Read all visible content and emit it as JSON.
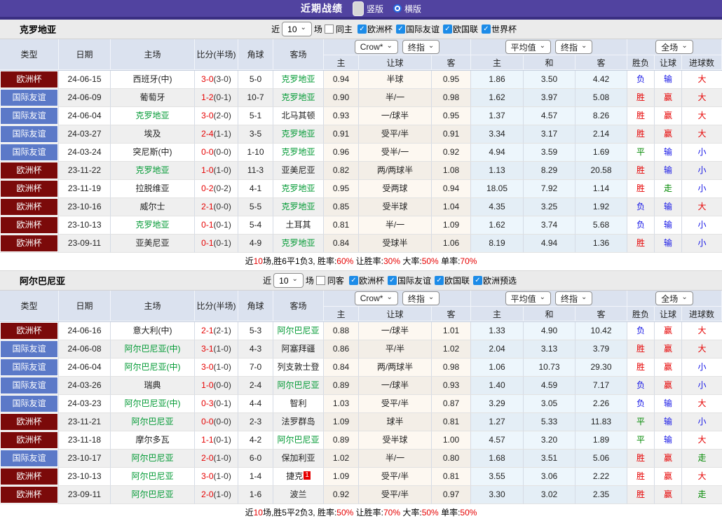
{
  "top": {
    "title": "近期战绩",
    "radios": [
      "竖版",
      "横版"
    ]
  },
  "colors": {
    "topbar": "#5143a0",
    "cup": "#7b0a0a",
    "friendly": "#5b79c8",
    "team_green": "#009933",
    "score_red": "#e60000",
    "win_red": "#e60000",
    "lose_blue": "#1414e6",
    "draw_green": "#008800"
  },
  "sections": [
    {
      "name": "克罗地亚",
      "filters": {
        "near": "近",
        "count": "10",
        "games": "场",
        "same": "同主",
        "leagues": [
          "欧洲杯",
          "国际友谊",
          "欧国联",
          "世界杯"
        ]
      },
      "dropdowns": {
        "book": "Crow*",
        "final1": "终指",
        "avg": "平均值",
        "final2": "终指",
        "scope": "全场"
      },
      "headers": {
        "type": "类型",
        "date": "日期",
        "home": "主场",
        "score": "比分(半场)",
        "corner": "角球",
        "away": "客场",
        "o_home": "主",
        "o_line": "让球",
        "o_away": "客",
        "a_home": "主",
        "a_draw": "和",
        "a_away": "客",
        "r_wl": "胜负",
        "r_handicap": "让球",
        "r_goals": "进球数"
      },
      "rows": [
        {
          "type": "欧洲杯",
          "date": "24-06-15",
          "home": "西班牙(中)",
          "score": "3-0",
          "half": "(3-0)",
          "corner": "5-0",
          "away": "克罗地亚",
          "o1": "0.94",
          "line": "半球",
          "o2": "0.95",
          "a1": "1.86",
          "a2": "3.50",
          "a3": "4.42",
          "r1": "负",
          "r2": "输",
          "r3": "大"
        },
        {
          "type": "国际友谊",
          "date": "24-06-09",
          "home": "葡萄牙",
          "score": "1-2",
          "half": "(0-1)",
          "corner": "10-7",
          "away": "克罗地亚",
          "o1": "0.90",
          "line": "半/一",
          "o2": "0.98",
          "a1": "1.62",
          "a2": "3.97",
          "a3": "5.08",
          "r1": "胜",
          "r2": "赢",
          "r3": "大"
        },
        {
          "type": "国际友谊",
          "date": "24-06-04",
          "home": "克罗地亚",
          "score": "3-0",
          "half": "(2-0)",
          "corner": "5-1",
          "away": "北马其顿",
          "o1": "0.93",
          "line": "一/球半",
          "o2": "0.95",
          "a1": "1.37",
          "a2": "4.57",
          "a3": "8.26",
          "r1": "胜",
          "r2": "赢",
          "r3": "大"
        },
        {
          "type": "国际友谊",
          "date": "24-03-27",
          "home": "埃及",
          "score": "2-4",
          "half": "(1-1)",
          "corner": "3-5",
          "away": "克罗地亚",
          "o1": "0.91",
          "line": "受平/半",
          "o2": "0.91",
          "a1": "3.34",
          "a2": "3.17",
          "a3": "2.14",
          "r1": "胜",
          "r2": "赢",
          "r3": "大"
        },
        {
          "type": "国际友谊",
          "date": "24-03-24",
          "home": "突尼斯(中)",
          "score": "0-0",
          "half": "(0-0)",
          "corner": "1-10",
          "away": "克罗地亚",
          "o1": "0.96",
          "line": "受半/一",
          "o2": "0.92",
          "a1": "4.94",
          "a2": "3.59",
          "a3": "1.69",
          "r1": "平",
          "r2": "输",
          "r3": "小"
        },
        {
          "type": "欧洲杯",
          "date": "23-11-22",
          "home": "克罗地亚",
          "score": "1-0",
          "half": "(1-0)",
          "corner": "11-3",
          "away": "亚美尼亚",
          "o1": "0.82",
          "line": "两/两球半",
          "o2": "1.08",
          "a1": "1.13",
          "a2": "8.29",
          "a3": "20.58",
          "r1": "胜",
          "r2": "输",
          "r3": "小"
        },
        {
          "type": "欧洲杯",
          "date": "23-11-19",
          "home": "拉脱维亚",
          "score": "0-2",
          "half": "(0-2)",
          "corner": "4-1",
          "away": "克罗地亚",
          "o1": "0.95",
          "line": "受两球",
          "o2": "0.94",
          "a1": "18.05",
          "a2": "7.92",
          "a3": "1.14",
          "r1": "胜",
          "r2": "走",
          "r3": "小"
        },
        {
          "type": "欧洲杯",
          "date": "23-10-16",
          "home": "威尔士",
          "score": "2-1",
          "half": "(0-0)",
          "corner": "5-5",
          "away": "克罗地亚",
          "o1": "0.85",
          "line": "受半球",
          "o2": "1.04",
          "a1": "4.35",
          "a2": "3.25",
          "a3": "1.92",
          "r1": "负",
          "r2": "输",
          "r3": "大"
        },
        {
          "type": "欧洲杯",
          "date": "23-10-13",
          "home": "克罗地亚",
          "score": "0-1",
          "half": "(0-1)",
          "corner": "5-4",
          "away": "土耳其",
          "o1": "0.81",
          "line": "半/一",
          "o2": "1.09",
          "a1": "1.62",
          "a2": "3.74",
          "a3": "5.68",
          "r1": "负",
          "r2": "输",
          "r3": "小"
        },
        {
          "type": "欧洲杯",
          "date": "23-09-11",
          "home": "亚美尼亚",
          "score": "0-1",
          "half": "(0-1)",
          "corner": "4-9",
          "away": "克罗地亚",
          "o1": "0.84",
          "line": "受球半",
          "o2": "1.06",
          "a1": "8.19",
          "a2": "4.94",
          "a3": "1.36",
          "r1": "胜",
          "r2": "输",
          "r3": "小"
        }
      ],
      "summary": [
        {
          "t": "近"
        },
        {
          "t": "10",
          "red": true
        },
        {
          "t": "场,胜6平1负3, 胜率:"
        },
        {
          "t": "60%",
          "red": true
        },
        {
          "t": " 让胜率:"
        },
        {
          "t": "30%",
          "red": true
        },
        {
          "t": " 大率:"
        },
        {
          "t": "50%",
          "red": true
        },
        {
          "t": " 单率:"
        },
        {
          "t": "70%",
          "red": true
        }
      ]
    },
    {
      "name": "阿尔巴尼亚",
      "filters": {
        "near": "近",
        "count": "10",
        "games": "场",
        "same": "同客",
        "leagues": [
          "欧洲杯",
          "国际友谊",
          "欧国联",
          "欧洲预选"
        ]
      },
      "dropdowns": {
        "book": "Crow*",
        "final1": "终指",
        "avg": "平均值",
        "final2": "终指",
        "scope": "全场"
      },
      "headers": {
        "type": "类型",
        "date": "日期",
        "home": "主场",
        "score": "比分(半场)",
        "corner": "角球",
        "away": "客场",
        "o_home": "主",
        "o_line": "让球",
        "o_away": "客",
        "a_home": "主",
        "a_draw": "和",
        "a_away": "客",
        "r_wl": "胜负",
        "r_handicap": "让球",
        "r_goals": "进球数"
      },
      "rows": [
        {
          "type": "欧洲杯",
          "date": "24-06-16",
          "home": "意大利(中)",
          "score": "2-1",
          "half": "(2-1)",
          "corner": "5-3",
          "away": "阿尔巴尼亚",
          "o1": "0.88",
          "line": "一/球半",
          "o2": "1.01",
          "a1": "1.33",
          "a2": "4.90",
          "a3": "10.42",
          "r1": "负",
          "r2": "赢",
          "r3": "大"
        },
        {
          "type": "国际友谊",
          "date": "24-06-08",
          "home": "阿尔巴尼亚(中)",
          "score": "3-1",
          "half": "(1-0)",
          "corner": "4-3",
          "away": "阿塞拜疆",
          "o1": "0.86",
          "line": "平/半",
          "o2": "1.02",
          "a1": "2.04",
          "a2": "3.13",
          "a3": "3.79",
          "r1": "胜",
          "r2": "赢",
          "r3": "大"
        },
        {
          "type": "国际友谊",
          "date": "24-06-04",
          "home": "阿尔巴尼亚(中)",
          "score": "3-0",
          "half": "(1-0)",
          "corner": "7-0",
          "away": "列支敦士登",
          "o1": "0.84",
          "line": "两/两球半",
          "o2": "0.98",
          "a1": "1.06",
          "a2": "10.73",
          "a3": "29.30",
          "r1": "胜",
          "r2": "赢",
          "r3": "小"
        },
        {
          "type": "国际友谊",
          "date": "24-03-26",
          "home": "瑞典",
          "score": "1-0",
          "half": "(0-0)",
          "corner": "2-4",
          "away": "阿尔巴尼亚",
          "o1": "0.89",
          "line": "一/球半",
          "o2": "0.93",
          "a1": "1.40",
          "a2": "4.59",
          "a3": "7.17",
          "r1": "负",
          "r2": "赢",
          "r3": "小"
        },
        {
          "type": "国际友谊",
          "date": "24-03-23",
          "home": "阿尔巴尼亚(中)",
          "score": "0-3",
          "half": "(0-1)",
          "corner": "4-4",
          "away": "智利",
          "o1": "1.03",
          "line": "受平/半",
          "o2": "0.87",
          "a1": "3.29",
          "a2": "3.05",
          "a3": "2.26",
          "r1": "负",
          "r2": "输",
          "r3": "大"
        },
        {
          "type": "欧洲杯",
          "date": "23-11-21",
          "home": "阿尔巴尼亚",
          "score": "0-0",
          "half": "(0-0)",
          "corner": "2-3",
          "away": "法罗群岛",
          "o1": "1.09",
          "line": "球半",
          "o2": "0.81",
          "a1": "1.27",
          "a2": "5.33",
          "a3": "11.83",
          "r1": "平",
          "r2": "输",
          "r3": "小"
        },
        {
          "type": "欧洲杯",
          "date": "23-11-18",
          "home": "摩尔多瓦",
          "score": "1-1",
          "half": "(0-1)",
          "corner": "4-2",
          "away": "阿尔巴尼亚",
          "o1": "0.89",
          "line": "受半球",
          "o2": "1.00",
          "a1": "4.57",
          "a2": "3.20",
          "a3": "1.89",
          "r1": "平",
          "r2": "输",
          "r3": "大"
        },
        {
          "type": "国际友谊",
          "date": "23-10-17",
          "home": "阿尔巴尼亚",
          "score": "2-0",
          "half": "(1-0)",
          "corner": "6-0",
          "away": "保加利亚",
          "o1": "1.02",
          "line": "半/一",
          "o2": "0.80",
          "a1": "1.68",
          "a2": "3.51",
          "a3": "5.06",
          "r1": "胜",
          "r2": "赢",
          "r3": "走"
        },
        {
          "type": "欧洲杯",
          "date": "23-10-13",
          "home": "阿尔巴尼亚",
          "score": "3-0",
          "half": "(1-0)",
          "corner": "1-4",
          "away": "捷克",
          "badge": "1",
          "o1": "1.09",
          "line": "受平/半",
          "o2": "0.81",
          "a1": "3.55",
          "a2": "3.06",
          "a3": "2.22",
          "r1": "胜",
          "r2": "赢",
          "r3": "大"
        },
        {
          "type": "欧洲杯",
          "date": "23-09-11",
          "home": "阿尔巴尼亚",
          "score": "2-0",
          "half": "(1-0)",
          "corner": "1-6",
          "away": "波兰",
          "o1": "0.92",
          "line": "受平/半",
          "o2": "0.97",
          "a1": "3.30",
          "a2": "3.02",
          "a3": "2.35",
          "r1": "胜",
          "r2": "赢",
          "r3": "走"
        }
      ],
      "summary": [
        {
          "t": "近"
        },
        {
          "t": "10",
          "red": true
        },
        {
          "t": "场,胜5平2负3, 胜率:"
        },
        {
          "t": "50%",
          "red": true
        },
        {
          "t": " 让胜率:"
        },
        {
          "t": "70%",
          "red": true
        },
        {
          "t": " 大率:"
        },
        {
          "t": "50%",
          "red": true
        },
        {
          "t": " 单率:"
        },
        {
          "t": "50%",
          "red": true
        }
      ]
    }
  ]
}
